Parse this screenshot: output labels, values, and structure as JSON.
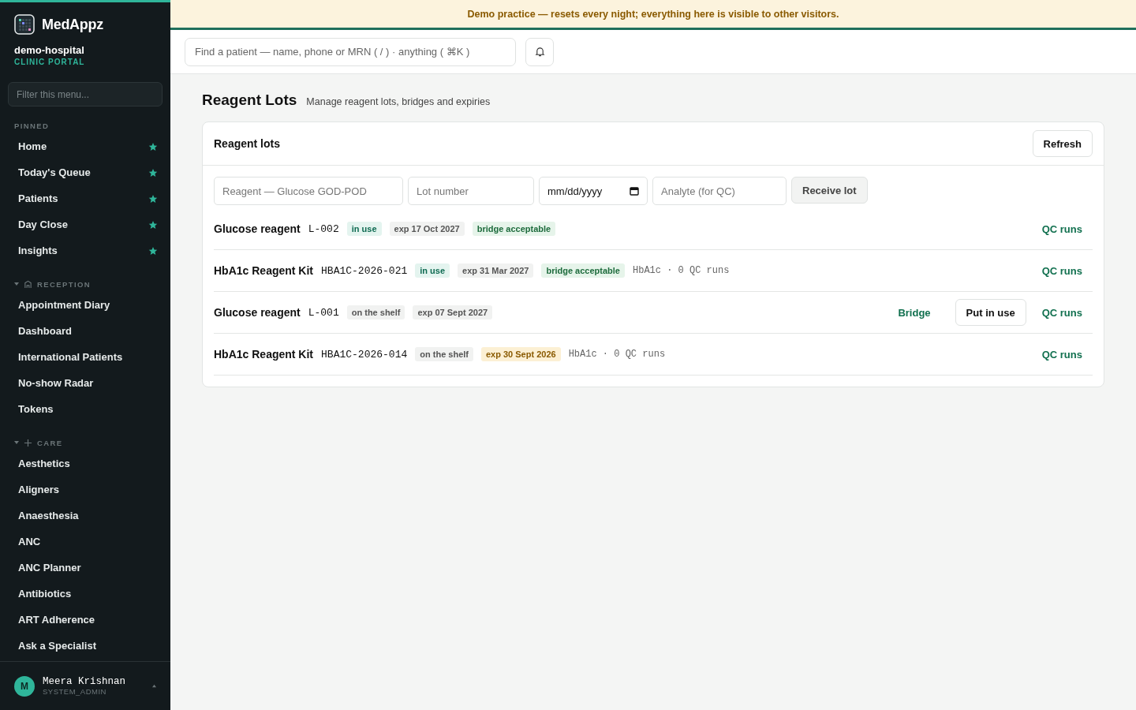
{
  "brand": {
    "name": "MedAppz",
    "org": "demo-hospital",
    "portal": "CLINIC PORTAL"
  },
  "sidebar": {
    "filter_placeholder": "Filter this menu...",
    "sections": [
      {
        "title": "PINNED",
        "kind": "pinned",
        "items": [
          {
            "label": "Home",
            "starred": true
          },
          {
            "label": "Today's Queue",
            "starred": true
          },
          {
            "label": "Patients",
            "starred": true
          },
          {
            "label": "Day Close",
            "starred": true
          },
          {
            "label": "Insights",
            "starred": true
          }
        ]
      },
      {
        "title": "RECEPTION",
        "kind": "reception",
        "expanded": true,
        "items": [
          {
            "label": "Appointment Diary",
            "starred": false
          },
          {
            "label": "Dashboard",
            "starred": false
          },
          {
            "label": "International Patients",
            "starred": false
          },
          {
            "label": "No-show Radar",
            "starred": false
          },
          {
            "label": "Tokens",
            "starred": false
          }
        ]
      },
      {
        "title": "CARE",
        "kind": "care",
        "expanded": true,
        "items": [
          {
            "label": "Aesthetics",
            "starred": false
          },
          {
            "label": "Aligners",
            "starred": false
          },
          {
            "label": "Anaesthesia",
            "starred": false
          },
          {
            "label": "ANC",
            "starred": false
          },
          {
            "label": "ANC Planner",
            "starred": false
          },
          {
            "label": "Antibiotics",
            "starred": false
          },
          {
            "label": "ART Adherence",
            "starred": false
          },
          {
            "label": "Ask a Specialist",
            "starred": false
          }
        ]
      }
    ]
  },
  "user": {
    "initial": "M",
    "name": "Meera Krishnan",
    "role": "SYSTEM_ADMIN"
  },
  "banner": "Demo practice — resets every night; everything here is visible to other visitors.",
  "search": {
    "placeholder": "Find a patient — name, phone or MRN ( / ) · anything ( ⌘K )"
  },
  "page": {
    "title": "Reagent Lots",
    "subtitle": "Manage reagent lots, bridges and expiries"
  },
  "card": {
    "title": "Reagent lots",
    "refresh": "Refresh",
    "form": {
      "reagent_placeholder": "Reagent — Glucose GOD-POD",
      "lot_placeholder": "Lot number",
      "date_value": "mm/dd/yyyy",
      "analyte_placeholder": "Analyte (for QC)",
      "submit": "Receive lot"
    },
    "lots": [
      {
        "name": "Glucose reagent",
        "code": "L-002",
        "tags": [
          {
            "text": "in use",
            "kind": "active"
          },
          {
            "text": "exp 17 Oct 2027",
            "kind": "neutral"
          },
          {
            "text": "bridge acceptable",
            "kind": "good"
          }
        ],
        "actions": [
          {
            "label": "QC runs",
            "kind": "link"
          }
        ]
      },
      {
        "name": "HbA1c Reagent Kit",
        "code": "HBA1C-2026-021",
        "tags": [
          {
            "text": "in use",
            "kind": "active"
          },
          {
            "text": "exp 31 Mar 2027",
            "kind": "neutral"
          },
          {
            "text": "bridge acceptable",
            "kind": "good"
          }
        ],
        "meta": "HbA1c · 0 QC runs",
        "actions": [
          {
            "label": "QC runs",
            "kind": "link"
          }
        ]
      },
      {
        "name": "Glucose reagent",
        "code": "L-001",
        "tags": [
          {
            "text": "on the shelf",
            "kind": "neutral"
          },
          {
            "text": "exp 07 Sept 2027",
            "kind": "neutral"
          }
        ],
        "actions": [
          {
            "label": "Bridge",
            "kind": "link"
          },
          {
            "label": "Put in use",
            "kind": "button"
          },
          {
            "label": "QC runs",
            "kind": "link"
          }
        ]
      },
      {
        "name": "HbA1c Reagent Kit",
        "code": "HBA1C-2026-014",
        "tags": [
          {
            "text": "on the shelf",
            "kind": "neutral"
          },
          {
            "text": "exp 30 Sept 2026",
            "kind": "warning"
          }
        ],
        "meta": "HbA1c · 0 QC runs",
        "actions": [
          {
            "label": "QC runs",
            "kind": "link"
          }
        ]
      }
    ]
  }
}
